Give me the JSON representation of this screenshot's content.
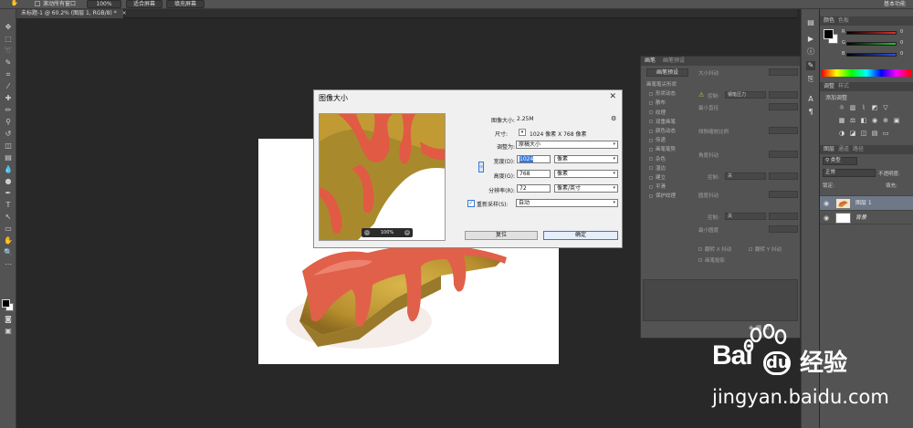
{
  "options_bar": {
    "scroll_all_label": "滚动所有窗口",
    "zoom_value": "100%",
    "fit_screen": "适合屏幕",
    "fill_screen": "填充屏幕",
    "workspace": "基本功能"
  },
  "document_tab": {
    "title": "未标题-1 @ 60.2% (图层 1, RGB/8) *",
    "close": "×"
  },
  "dialog": {
    "title": "图像大小",
    "close": "✕",
    "image_size_label": "图像大小:",
    "image_size_value": "2.25M",
    "dimensions_label": "尺寸:",
    "dimensions_value": "1024 像素  X  768 像素",
    "fit_to_label": "调整为:",
    "fit_to_value": "原稿大小",
    "width_label": "宽度(D):",
    "width_value": "1024",
    "width_unit": "像素",
    "height_label": "高度(G):",
    "height_value": "768",
    "height_unit": "像素",
    "resolution_label": "分辨率(R):",
    "resolution_value": "72",
    "resolution_unit": "像素/英寸",
    "resample_label": "重新采样(S):",
    "resample_value": "自动",
    "preview_zoom": "100%",
    "reset_button": "复位",
    "ok_button": "确定",
    "resample_checked": true
  },
  "brush_panel": {
    "tabs": [
      "画笔",
      "画笔预设"
    ],
    "preset_button": "画笔预设",
    "items": [
      "画笔笔尖形状",
      "形状动态",
      "散布",
      "纹理",
      "双重画笔",
      "颜色动态",
      "传递",
      "画笔笔势",
      "杂色",
      "湿边",
      "建立",
      "平滑",
      "保护纹理"
    ],
    "right_labels": {
      "size_jitter": "大小抖动",
      "control": "控制:",
      "pen_pressure": "钢笔压力",
      "min_diameter": "最小直径",
      "tilt_scale": "倾斜缩放比例",
      "angle_jitter": "角度抖动",
      "control2": "控制:",
      "off": "关",
      "roundness_jitter": "圆度抖动",
      "control3": "控制:",
      "off2": "关",
      "min_roundness": "最小圆度",
      "flip_x": "翻转 X 抖动",
      "flip_y": "翻转 Y 抖动",
      "brush_projection": "画笔投影"
    }
  },
  "color_panel": {
    "tabs": [
      "颜色",
      "色板"
    ],
    "channels": [
      {
        "letter": "R",
        "value": "0",
        "color": "#e03030"
      },
      {
        "letter": "G",
        "value": "0",
        "color": "#30c030"
      },
      {
        "letter": "B",
        "value": "0",
        "color": "#3050e0"
      }
    ]
  },
  "adjust_panel": {
    "tabs": [
      "调整",
      "样式"
    ],
    "add_label": "添加调整"
  },
  "layers_panel": {
    "tabs": [
      "图层",
      "通道",
      "路径"
    ],
    "kind": "类型",
    "blend_mode": "正常",
    "opacity": "不透明度:",
    "lock": "锁定:",
    "fill": "填充:",
    "layers": [
      {
        "name": "图层 1",
        "selected": true
      },
      {
        "name": "背景",
        "selected": false
      }
    ]
  },
  "watermark": {
    "brand": "Bai",
    "brand2": "经验",
    "url": "jingyan.baidu.com"
  }
}
